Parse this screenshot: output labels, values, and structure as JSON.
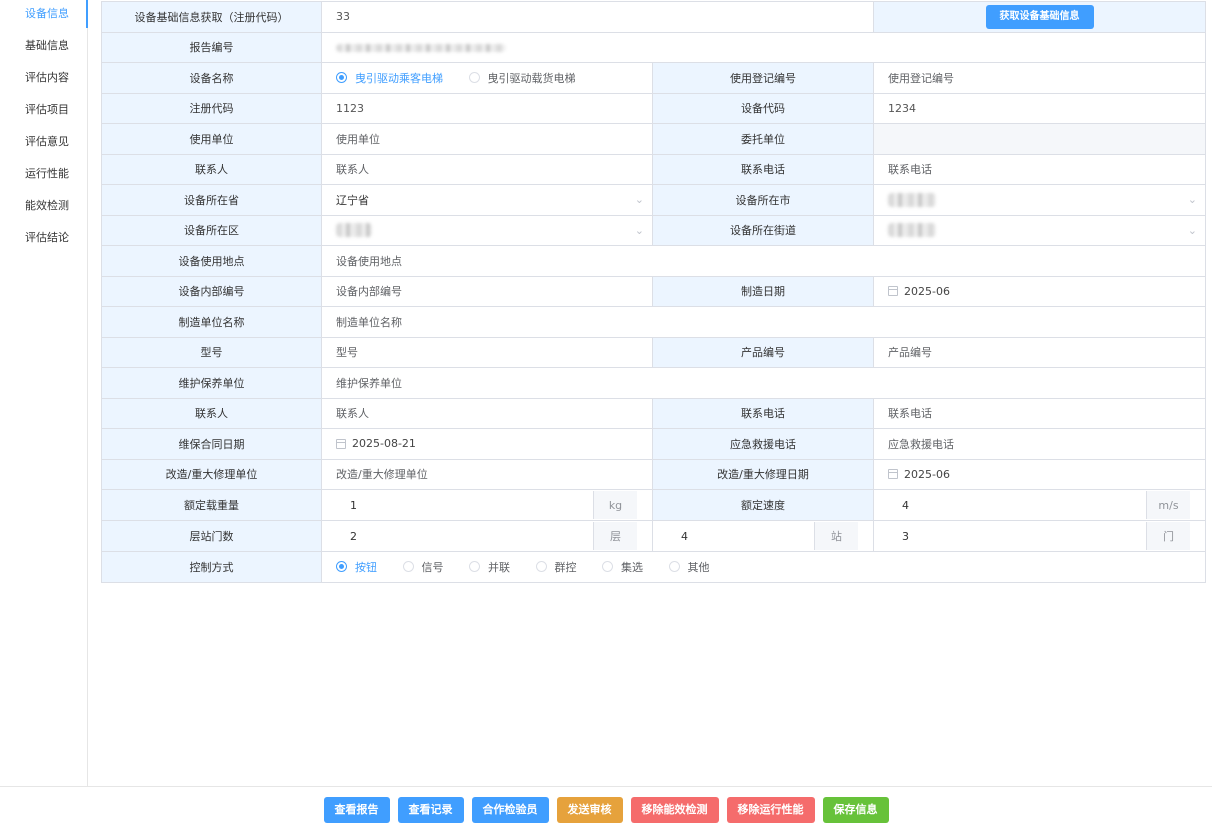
{
  "sidebar": {
    "items": [
      {
        "label": "设备信息",
        "active": true
      },
      {
        "label": "基础信息"
      },
      {
        "label": "评估内容"
      },
      {
        "label": "评估项目"
      },
      {
        "label": "评估意见"
      },
      {
        "label": "运行性能"
      },
      {
        "label": "能效检测"
      },
      {
        "label": "评估结论"
      }
    ]
  },
  "form": {
    "fetch_label": "设备基础信息获取（注册代码）",
    "fetch_value": "33",
    "fetch_button": "获取设备基础信息",
    "report_no_label": "报告编号",
    "device_name_label": "设备名称",
    "device_name_options": [
      "曳引驱动乘客电梯",
      "曳引驱动载货电梯"
    ],
    "device_name_selected": 0,
    "use_reg_no_label": "使用登记编号",
    "use_reg_no_placeholder": "使用登记编号",
    "reg_code_label": "注册代码",
    "reg_code_value": "1123",
    "device_code_label": "设备代码",
    "device_code_value": "1234",
    "user_unit_label": "使用单位",
    "user_unit_placeholder": "使用单位",
    "entrust_unit_label": "委托单位",
    "contact_label": "联系人",
    "contact_placeholder": "联系人",
    "phone_label": "联系电话",
    "phone_placeholder": "联系电话",
    "province_label": "设备所在省",
    "province_value": "辽宁省",
    "city_label": "设备所在市",
    "district_label": "设备所在区",
    "street_label": "设备所在街道",
    "location_label": "设备使用地点",
    "location_placeholder": "设备使用地点",
    "internal_no_label": "设备内部编号",
    "internal_no_placeholder": "设备内部编号",
    "mfg_date_label": "制造日期",
    "mfg_date_value": "2025-06",
    "manufacturer_label": "制造单位名称",
    "manufacturer_placeholder": "制造单位名称",
    "model_label": "型号",
    "model_placeholder": "型号",
    "product_no_label": "产品编号",
    "product_no_placeholder": "产品编号",
    "maint_unit_label": "维护保养单位",
    "maint_unit_placeholder": "维护保养单位",
    "maint_contact_label": "联系人",
    "maint_contact_placeholder": "联系人",
    "maint_phone_label": "联系电话",
    "maint_phone_placeholder": "联系电话",
    "maint_contract_label": "维保合同日期",
    "maint_contract_value": "2025-08-21",
    "emergency_label": "应急救援电话",
    "emergency_placeholder": "应急救援电话",
    "repair_unit_label": "改造/重大修理单位",
    "repair_unit_placeholder": "改造/重大修理单位",
    "repair_date_label": "改造/重大修理日期",
    "repair_date_value": "2025-06",
    "load_label": "额定载重量",
    "load_value": "1",
    "load_unit": "kg",
    "speed_label": "额定速度",
    "speed_value": "4",
    "speed_unit": "m/s",
    "floors_label": "层站门数",
    "floors_value": "2",
    "floors_unit": "层",
    "stations_value": "4",
    "stations_unit": "站",
    "doors_value": "3",
    "doors_unit": "门",
    "control_label": "控制方式",
    "control_options": [
      "按钮",
      "信号",
      "并联",
      "群控",
      "集选",
      "其他"
    ],
    "control_selected": 0
  },
  "footer": {
    "buttons": [
      {
        "label": "查看报告",
        "color": "#409eff"
      },
      {
        "label": "查看记录",
        "color": "#409eff"
      },
      {
        "label": "合作检验员",
        "color": "#409eff"
      },
      {
        "label": "发送审核",
        "color": "#e6a23c"
      },
      {
        "label": "移除能效检测",
        "color": "#f56c6c"
      },
      {
        "label": "移除运行性能",
        "color": "#f56c6c"
      },
      {
        "label": "保存信息",
        "color": "#67c23a"
      }
    ]
  },
  "colors": {
    "accent": "#409eff",
    "label_bg": "#ecf5ff",
    "border": "#dcdfe6"
  }
}
